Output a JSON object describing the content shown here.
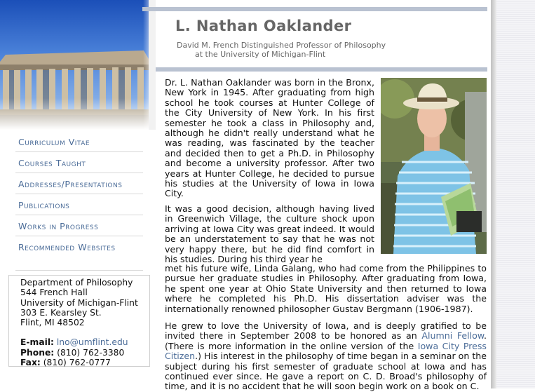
{
  "header": {
    "name": "L. Nathan Oaklander",
    "subtitle_line1": "David M. French Distinguished Professor of Philosophy",
    "subtitle_line2": "at the University of Michigan-Flint"
  },
  "nav": {
    "items": [
      {
        "label": "Curriculum Vitae"
      },
      {
        "label": "Courses Taught"
      },
      {
        "label": "Addresses/Presentations"
      },
      {
        "label": "Publications"
      },
      {
        "label": "Works in Progress"
      },
      {
        "label": "Recommended Websites"
      }
    ]
  },
  "contact": {
    "department": "Department of Philosophy",
    "office": "544 French Hall",
    "university": "University of Michigan-Flint",
    "street": "303 E. Kearsley St.",
    "city": "Flint, MI 48502",
    "email_label": "E-mail:",
    "email": "lno@umflint.edu",
    "phone_label": "Phone:",
    "phone": "(810) 762-3380",
    "fax_label": "Fax:",
    "fax": "(810) 762-0777"
  },
  "bio": {
    "p1": "Dr. L. Nathan Oaklander was born in the Bronx, New York in 1945. After graduating from high school he took courses at Hunter College of the City University of New York. In his first semester he took a class in Philosophy and, although he didn't really understand what he was reading, was fascinated by the teacher and decided then to get a Ph.D. in Philosophy and become a university professor. After two years at Hunter College, he decided to pursue his studies at the University of Iowa in Iowa City.",
    "p2a": "It was a good decision, although having lived in Greenwich Village, the culture shock upon arriving at Iowa City was great indeed. It would be an understatement to say that he was not very happy there, but he did find comfort in his studies. During his third year he",
    "p2b": "met his future wife, Linda Galang, who had come from the Philippines to pursue her graduate studies in Philosophy. After graduating from Iowa, he spent one year at Ohio State University and then returned to Iowa where he completed his Ph.D. His dissertation adviser was the internationally renowned philosopher Gustav Bergmann (1906-1987).",
    "p3_part1": "He grew to love the University of Iowa, and is deeply gratified to be invited there in September 2008 to be honored as an ",
    "p3_link1": "Alumni Fellow",
    "p3_part2": ". (There is more information in the online version of the ",
    "p3_link2": "Iowa City Press Citizen",
    "p3_part3": ".) His interest in the philosophy of time began in a seminar on the subject during his first semester of graduate school at Iowa and has continued ever since. He gave a report on C. D. Broad's philosophy of time, and it is no accident that he will soon begin work on a book on C."
  },
  "colors": {
    "link": "#4b6c98",
    "rule": "#b9c2d1",
    "title": "#666666"
  }
}
